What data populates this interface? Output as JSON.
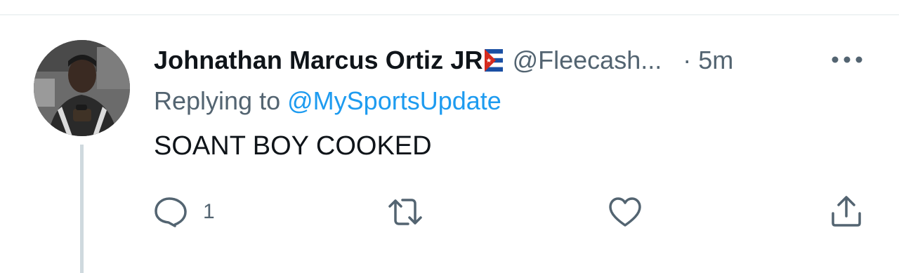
{
  "tweet": {
    "display_name": "Johnathan Marcus Ortiz JR",
    "handle": "@Fleecash...",
    "separator": "·",
    "time": "5m",
    "replying_prefix": "Replying to",
    "replying_to": "@MySportsUpdate",
    "text": "SOANT BOY COOKED"
  },
  "actions": {
    "reply_count": "1"
  },
  "icons": {
    "avatar": "user-avatar-photo",
    "flag": "cuba-flag-emoji",
    "more": "more-dots-icon",
    "reply": "reply-bubble-icon",
    "retweet": "retweet-icon",
    "like": "heart-icon",
    "share": "share-upload-icon"
  },
  "colors": {
    "primary_text": "#0f1419",
    "secondary_text": "#536471",
    "link": "#1d9bf0",
    "thread_line": "#cfd9de"
  }
}
